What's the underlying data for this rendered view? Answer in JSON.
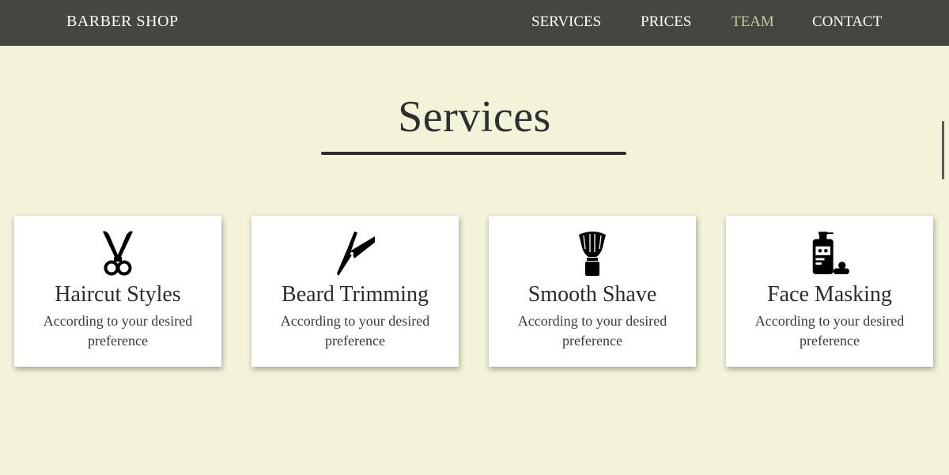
{
  "nav": {
    "brand": "BARBER SHOP",
    "links": [
      "SERVICES",
      "PRICES",
      "TEAM",
      "CONTACT"
    ],
    "active_link": "TEAM"
  },
  "section": {
    "title": "Services"
  },
  "cards": [
    {
      "icon": "scissors-icon",
      "title": "Haircut Styles",
      "text": "According to your desired preference"
    },
    {
      "icon": "straight-razor-icon",
      "title": "Beard Trimming",
      "text": "According to your desired preference"
    },
    {
      "icon": "shaving-brush-icon",
      "title": "Smooth Shave",
      "text": "According to your desired preference"
    },
    {
      "icon": "face-mask-bottle-icon",
      "title": "Face Masking",
      "text": "According to your desired preference"
    }
  ],
  "colors": {
    "background": "#f3f3da",
    "navbar": "#464640",
    "active_link": "#c9c9a0"
  }
}
